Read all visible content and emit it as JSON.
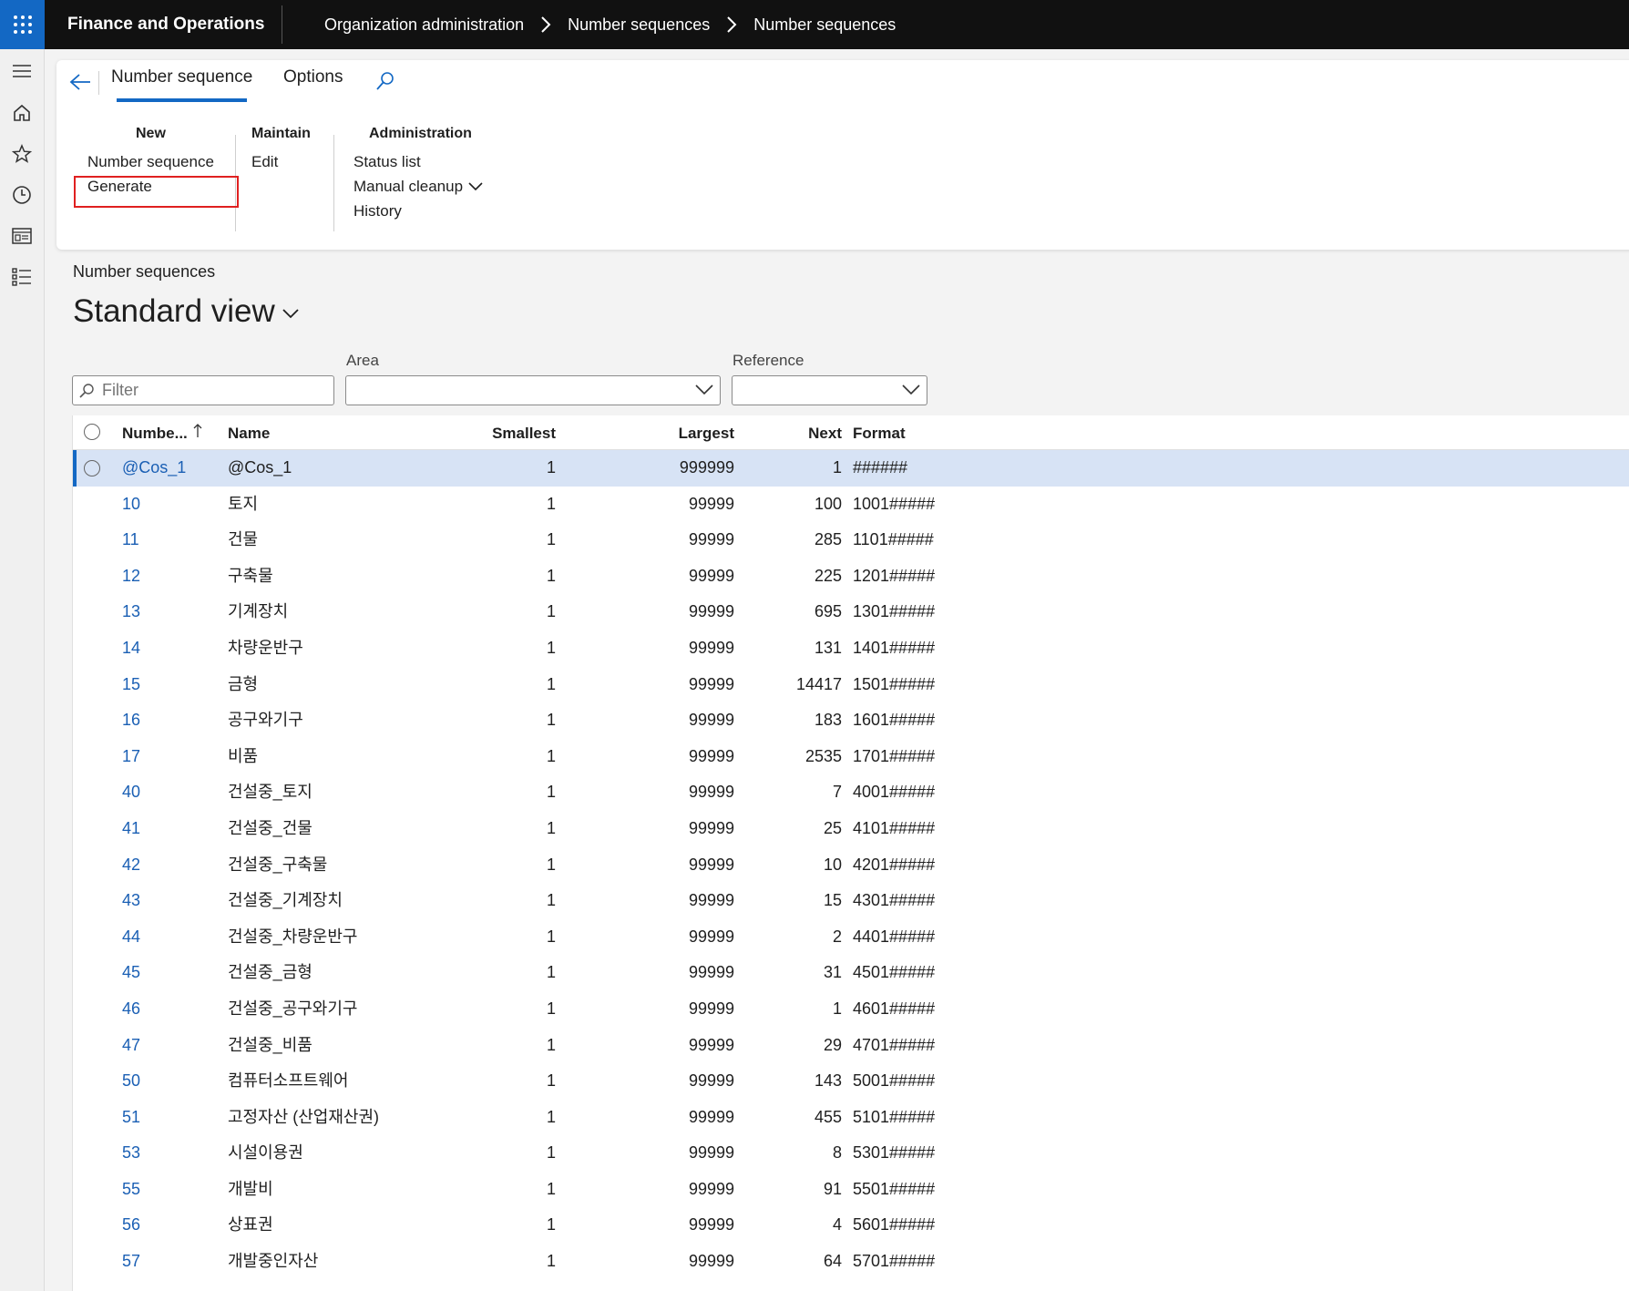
{
  "app": {
    "title": "Finance and Operations",
    "breadcrumbs": [
      "Organization administration",
      "Number sequences",
      "Number sequences"
    ]
  },
  "actionpane": {
    "tabs": [
      "Number sequence",
      "Options"
    ],
    "groups": {
      "new": {
        "header": "New",
        "items": [
          "Number sequence",
          "Generate"
        ]
      },
      "maintain": {
        "header": "Maintain",
        "items": [
          "Edit"
        ]
      },
      "administration": {
        "header": "Administration",
        "items": [
          "Status list",
          "Manual cleanup",
          "History"
        ]
      }
    }
  },
  "page": {
    "breadcrumb": "Number sequences",
    "view_title": "Standard view"
  },
  "filters": {
    "filter_placeholder": "Filter",
    "area_label": "Area",
    "reference_label": "Reference"
  },
  "grid": {
    "columns": [
      "Numbe...",
      "Name",
      "Smallest",
      "Largest",
      "Next",
      "Format"
    ],
    "rows": [
      {
        "code": "@Cos_1",
        "name": "@Cos_1",
        "smallest": "1",
        "largest": "999999",
        "next": "1",
        "format": "######"
      },
      {
        "code": "10",
        "name": "토지",
        "smallest": "1",
        "largest": "99999",
        "next": "100",
        "format": "1001#####"
      },
      {
        "code": "11",
        "name": "건물",
        "smallest": "1",
        "largest": "99999",
        "next": "285",
        "format": "1101#####"
      },
      {
        "code": "12",
        "name": "구축물",
        "smallest": "1",
        "largest": "99999",
        "next": "225",
        "format": "1201#####"
      },
      {
        "code": "13",
        "name": "기계장치",
        "smallest": "1",
        "largest": "99999",
        "next": "695",
        "format": "1301#####"
      },
      {
        "code": "14",
        "name": "차량운반구",
        "smallest": "1",
        "largest": "99999",
        "next": "131",
        "format": "1401#####"
      },
      {
        "code": "15",
        "name": "금형",
        "smallest": "1",
        "largest": "99999",
        "next": "14417",
        "format": "1501#####"
      },
      {
        "code": "16",
        "name": "공구와기구",
        "smallest": "1",
        "largest": "99999",
        "next": "183",
        "format": "1601#####"
      },
      {
        "code": "17",
        "name": "비품",
        "smallest": "1",
        "largest": "99999",
        "next": "2535",
        "format": "1701#####"
      },
      {
        "code": "40",
        "name": "건설중_토지",
        "smallest": "1",
        "largest": "99999",
        "next": "7",
        "format": "4001#####"
      },
      {
        "code": "41",
        "name": "건설중_건물",
        "smallest": "1",
        "largest": "99999",
        "next": "25",
        "format": "4101#####"
      },
      {
        "code": "42",
        "name": "건설중_구축물",
        "smallest": "1",
        "largest": "99999",
        "next": "10",
        "format": "4201#####"
      },
      {
        "code": "43",
        "name": "건설중_기계장치",
        "smallest": "1",
        "largest": "99999",
        "next": "15",
        "format": "4301#####"
      },
      {
        "code": "44",
        "name": "건설중_차량운반구",
        "smallest": "1",
        "largest": "99999",
        "next": "2",
        "format": "4401#####"
      },
      {
        "code": "45",
        "name": "건설중_금형",
        "smallest": "1",
        "largest": "99999",
        "next": "31",
        "format": "4501#####"
      },
      {
        "code": "46",
        "name": "건설중_공구와기구",
        "smallest": "1",
        "largest": "99999",
        "next": "1",
        "format": "4601#####"
      },
      {
        "code": "47",
        "name": "건설중_비품",
        "smallest": "1",
        "largest": "99999",
        "next": "29",
        "format": "4701#####"
      },
      {
        "code": "50",
        "name": "컴퓨터소프트웨어",
        "smallest": "1",
        "largest": "99999",
        "next": "143",
        "format": "5001#####"
      },
      {
        "code": "51",
        "name": "고정자산 (산업재산권)",
        "smallest": "1",
        "largest": "99999",
        "next": "455",
        "format": "5101#####"
      },
      {
        "code": "53",
        "name": "시설이용권",
        "smallest": "1",
        "largest": "99999",
        "next": "8",
        "format": "5301#####"
      },
      {
        "code": "55",
        "name": "개발비",
        "smallest": "1",
        "largest": "99999",
        "next": "91",
        "format": "5501#####"
      },
      {
        "code": "56",
        "name": "상표권",
        "smallest": "1",
        "largest": "99999",
        "next": "4",
        "format": "5601#####"
      },
      {
        "code": "57",
        "name": "개발중인자산",
        "smallest": "1",
        "largest": "99999",
        "next": "64",
        "format": "5701#####"
      }
    ]
  },
  "colors": {
    "accent": "#1368c4",
    "link": "#1a5fb4",
    "selected_row": "#d7e3f5",
    "highlight_box": "#e02020"
  },
  "icons": [
    "app-launcher-icon",
    "hamburger-icon",
    "home-icon",
    "star-icon",
    "clock-icon",
    "workspace-icon",
    "list-icon",
    "back-arrow-icon",
    "search-icon",
    "chevron-down-icon",
    "sort-up-icon"
  ]
}
